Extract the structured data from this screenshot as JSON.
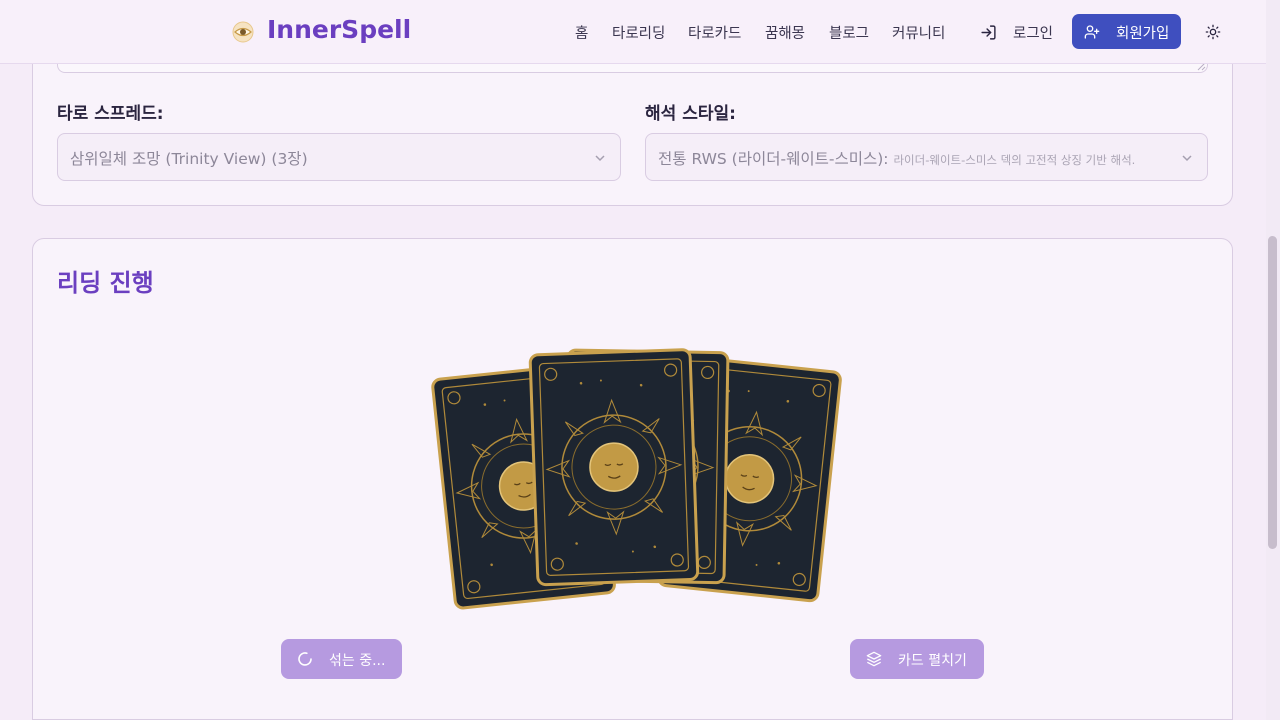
{
  "header": {
    "brand": "InnerSpell",
    "logo_icon": "eye-sun-logo-icon",
    "nav": [
      "홈",
      "타로리딩",
      "타로카드",
      "꿈해몽",
      "블로그",
      "커뮤니티"
    ],
    "login_label": "로그인",
    "signup_label": "회원가입",
    "theme_icon": "sun-icon"
  },
  "settings": {
    "spread_label": "타로 스프레드:",
    "spread_value": "삼위일체 조망 (Trinity View) (3장)",
    "style_label": "해석 스타일:",
    "style_value": "전통 RWS (라이더-웨이트-스미스):",
    "style_desc": "라이더-웨이트-스미스 덱의 고전적 상징 기반 해석."
  },
  "reading": {
    "title": "리딩 진행",
    "shuffle_label": "섞는 중...",
    "spread_cards_label": "카드 펼치기"
  },
  "colors": {
    "brand": "#6b3fc0",
    "primary_button": "#3f4fbf",
    "disabled_button": "#b69ae0",
    "card_back": "#1d2530",
    "card_gold": "#b08a3a"
  }
}
